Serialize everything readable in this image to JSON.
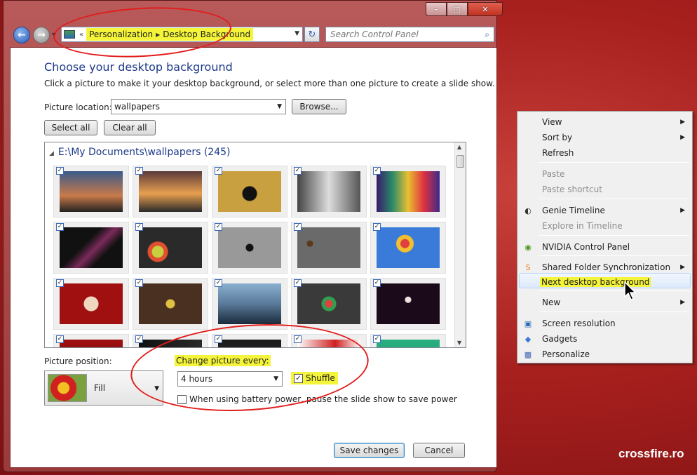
{
  "window": {
    "caption_buttons": {
      "minimize": "–",
      "maximize": "□",
      "close": "✕"
    },
    "breadcrumbs": [
      "Personalization",
      "Desktop Background"
    ],
    "search_placeholder": "Search Control Panel"
  },
  "main": {
    "heading": "Choose your desktop background",
    "subtitle": "Click a picture to make it your desktop background, or select more than one picture to create a slide show.",
    "picture_location_label": "Picture location:",
    "picture_location_value": "wallpapers",
    "browse_label": "Browse...",
    "select_all_label": "Select all",
    "clear_all_label": "Clear all",
    "folder_heading": "E:\\My Documents\\wallpapers (245)",
    "thumbnails": [
      {
        "icon": "city-dusk",
        "checked": true
      },
      {
        "icon": "sunset-sea",
        "checked": true
      },
      {
        "icon": "heart-on-sand",
        "checked": true
      },
      {
        "icon": "chess-pieces",
        "checked": true
      },
      {
        "icon": "color-streaks",
        "checked": true
      },
      {
        "icon": "dark-abstract",
        "checked": true
      },
      {
        "icon": "dot-pixels",
        "checked": true
      },
      {
        "icon": "gray-circle",
        "checked": true
      },
      {
        "icon": "gray-figure",
        "checked": true
      },
      {
        "icon": "balloon-house",
        "checked": true
      },
      {
        "icon": "flash-logo",
        "checked": true
      },
      {
        "icon": "brown-pattern",
        "checked": true
      },
      {
        "icon": "bridge-sky",
        "checked": true
      },
      {
        "icon": "pinwheel",
        "checked": true
      },
      {
        "icon": "dark-purple",
        "checked": true
      },
      {
        "icon": "red-partial",
        "checked": true
      },
      {
        "icon": "dark-partial",
        "checked": true
      },
      {
        "icon": "dark-partial-2",
        "checked": true
      },
      {
        "icon": "red-white-partial",
        "checked": true
      },
      {
        "icon": "green-partial",
        "checked": true
      }
    ],
    "picture_position_label": "Picture position:",
    "picture_position_value": "Fill",
    "change_picture_label": "Change picture every:",
    "change_interval_value": "4 hours",
    "shuffle_label": "Shuffle",
    "shuffle_checked": true,
    "battery_label": "When using battery power, pause the slide show to save power",
    "battery_checked": false,
    "save_label": "Save changes",
    "cancel_label": "Cancel"
  },
  "context_menu": {
    "items": [
      {
        "label": "View",
        "submenu": true,
        "disabled": false
      },
      {
        "label": "Sort by",
        "submenu": true,
        "disabled": false
      },
      {
        "label": "Refresh",
        "submenu": false,
        "disabled": false
      },
      {
        "label": "Paste",
        "submenu": false,
        "disabled": true
      },
      {
        "label": "Paste shortcut",
        "submenu": false,
        "disabled": true
      },
      {
        "label": "Genie Timeline",
        "submenu": true,
        "disabled": false,
        "icon": "genie-icon"
      },
      {
        "label": "Explore in Timeline",
        "submenu": false,
        "disabled": true
      },
      {
        "label": "NVIDIA Control Panel",
        "submenu": false,
        "disabled": false,
        "icon": "nvidia-icon"
      },
      {
        "label": "Shared Folder Synchronization",
        "submenu": true,
        "disabled": false,
        "icon": "sync-icon"
      },
      {
        "label": "Next desktop background",
        "submenu": false,
        "disabled": false,
        "highlighted": true
      },
      {
        "label": "New",
        "submenu": true,
        "disabled": false
      },
      {
        "label": "Screen resolution",
        "submenu": false,
        "disabled": false,
        "icon": "monitor-icon"
      },
      {
        "label": "Gadgets",
        "submenu": false,
        "disabled": false,
        "icon": "gadgets-icon"
      },
      {
        "label": "Personalize",
        "submenu": false,
        "disabled": false,
        "icon": "personalize-icon"
      }
    ]
  },
  "watermark": "crossfire.ro",
  "colors": {
    "highlight": "#f4f43a",
    "annotation": "#e21c1c",
    "heading": "#1e3a8a"
  }
}
